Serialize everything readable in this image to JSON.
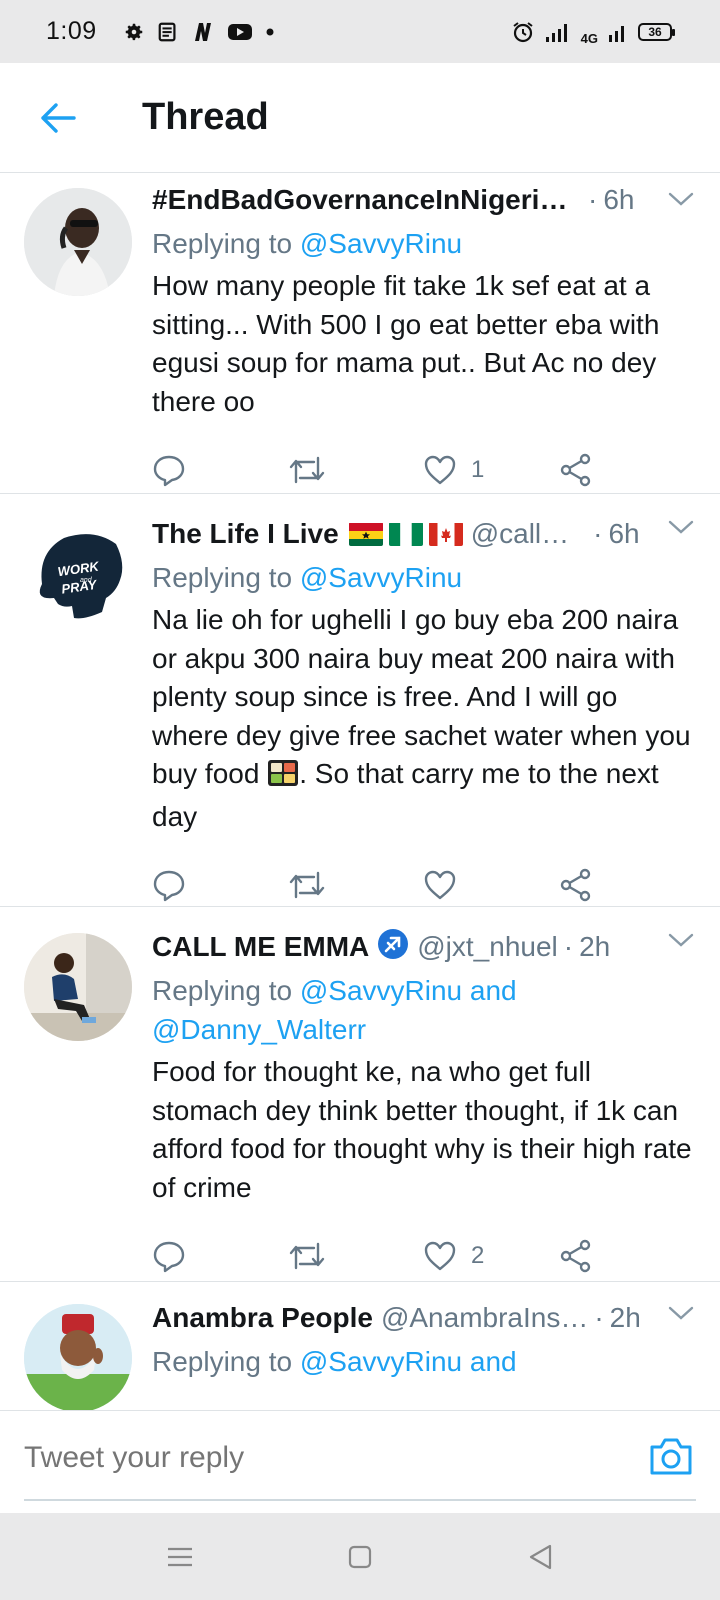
{
  "status_bar": {
    "time": "1:09",
    "network": "4G",
    "battery": "36"
  },
  "header": {
    "title": "Thread"
  },
  "tweets": [
    {
      "name": "#EndBadGovernanceInNigeria …",
      "handle": "",
      "dot": "·",
      "time": "6h",
      "replying_prefix": "Replying to ",
      "replying_to": "@SavvyRinu",
      "replying_extra": "",
      "body": "How many people fit take 1k sef eat at a sitting... With 500 I go eat better eba with egusi soup for mama put.. But Ac no dey there oo",
      "likes": "1"
    },
    {
      "name": "The Life I Live",
      "handle": "@call…",
      "dot": "·",
      "time": "6h",
      "replying_prefix": "Replying to ",
      "replying_to": "@SavvyRinu",
      "replying_extra": "",
      "body_a": "Na lie oh for ughelli I go buy eba 200 naira or akpu 300 naira buy meat 200 naira with plenty soup since is free. And I will go where dey give free sachet water when you buy food ",
      "body_b": ". So that carry me to the next day",
      "likes": ""
    },
    {
      "name": "CALL ME EMMA",
      "handle": "@jxt_nhuel",
      "dot": "·",
      "time": "2h",
      "replying_prefix": "Replying to ",
      "replying_to": "@SavvyRinu and @Danny_Walterr",
      "replying_extra": "",
      "body": "Food for thought ke, na who get full stomach dey think better thought, if 1k can afford food for thought why is their high rate of crime",
      "likes": "2"
    },
    {
      "name": "Anambra People",
      "handle": "@AnambraIns…",
      "dot": "·",
      "time": "2h",
      "replying_prefix": "Replying to ",
      "replying_to": "@SavvyRinu and",
      "replying_extra": "",
      "body": "",
      "likes": ""
    }
  ],
  "reply_bar": {
    "placeholder": "Tweet your reply"
  },
  "colors": {
    "accent": "#1da1f2",
    "secondary_text": "#657786",
    "divider": "#dfe3e6"
  }
}
